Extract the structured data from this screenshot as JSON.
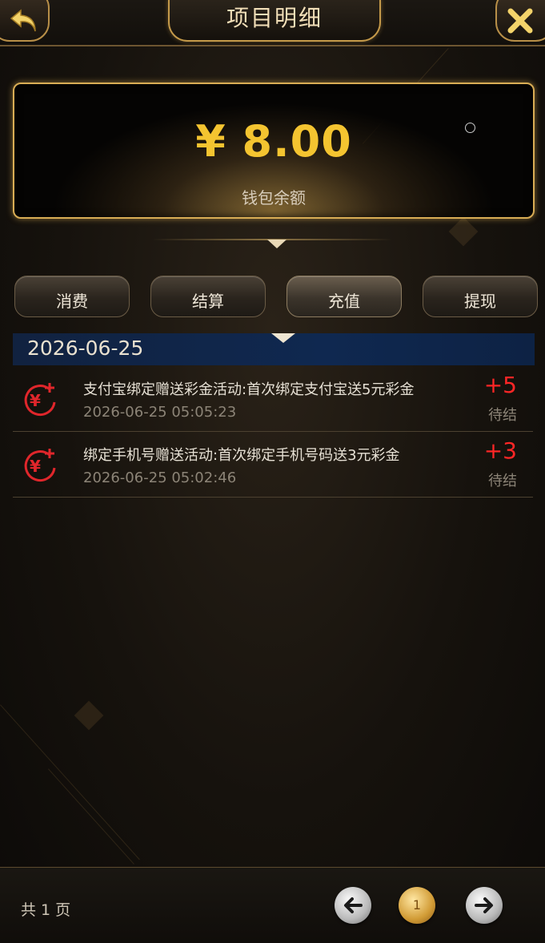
{
  "header": {
    "title": "项目明细"
  },
  "balance": {
    "amount": "¥ 8.00",
    "label": "钱包余额"
  },
  "tabs": [
    {
      "label": "消费",
      "active": false
    },
    {
      "label": "结算",
      "active": false
    },
    {
      "label": "充值",
      "active": true
    },
    {
      "label": "提现",
      "active": false
    }
  ],
  "date_group": "2026-06-25",
  "records": [
    {
      "icon": "yen-plus-icon",
      "title": "支付宝绑定赠送彩金活动:首次绑定支付宝送5元彩金",
      "time": "2026-06-25 05:05:23",
      "amount": "+5",
      "status": "待结"
    },
    {
      "icon": "yen-plus-icon",
      "title": "绑定手机号赠送活动:首次绑定手机号码送3元彩金",
      "time": "2026-06-25 05:02:46",
      "amount": "+3",
      "status": "待结"
    }
  ],
  "pagination": {
    "total_text": "共 1 页",
    "current_page": "1"
  },
  "colors": {
    "accent_gold": "#f4c430",
    "positive_red": "#ff2626",
    "date_bar": "#0f2850"
  }
}
